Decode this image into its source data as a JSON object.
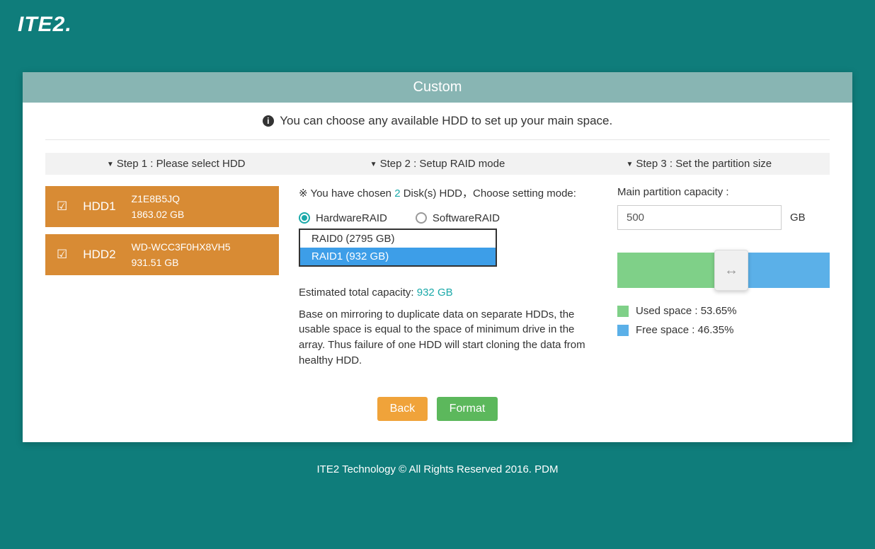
{
  "brand": "ITE2.",
  "header": {
    "title": "Custom"
  },
  "info": "You can choose any available HDD to set up your main space.",
  "steps": {
    "s1": "Step 1 : Please select HDD",
    "s2": "Step 2 : Setup RAID mode",
    "s3": "Step 3 : Set the partition size"
  },
  "hdds": [
    {
      "name": "HDD1",
      "serial": "Z1E8B5JQ",
      "size": "1863.02 GB"
    },
    {
      "name": "HDD2",
      "serial": "WD-WCC3F0HX8VH5",
      "size": "931.51 GB"
    }
  ],
  "raid": {
    "chosen_prefix": "※ You have chosen ",
    "chosen_count": "2",
    "chosen_suffix": " Disk(s) HDD，Choose setting mode:",
    "hw_label": "HardwareRAID",
    "sw_label": "SoftwareRAID",
    "options": [
      {
        "label": "RAID0 (2795 GB)",
        "selected": false
      },
      {
        "label": "RAID1 (932 GB)",
        "selected": true
      }
    ],
    "est_label": "Estimated total capacity: ",
    "est_value": "932 GB",
    "describe": "Base on mirroring to duplicate data on separate HDDs, the usable space is equal to the space of minimum drive in the array. Thus failure of one HDD will start cloning the data from healthy HDD."
  },
  "partition": {
    "label": "Main partition capacity :",
    "value": "500",
    "unit": "GB",
    "used_pct": 53.65,
    "free_pct": 46.35,
    "used_label": "Used space : 53.65%",
    "free_label": "Free space : 46.35%"
  },
  "buttons": {
    "back": "Back",
    "format": "Format"
  },
  "footer": "ITE2 Technology © All Rights Reserved 2016. PDM"
}
